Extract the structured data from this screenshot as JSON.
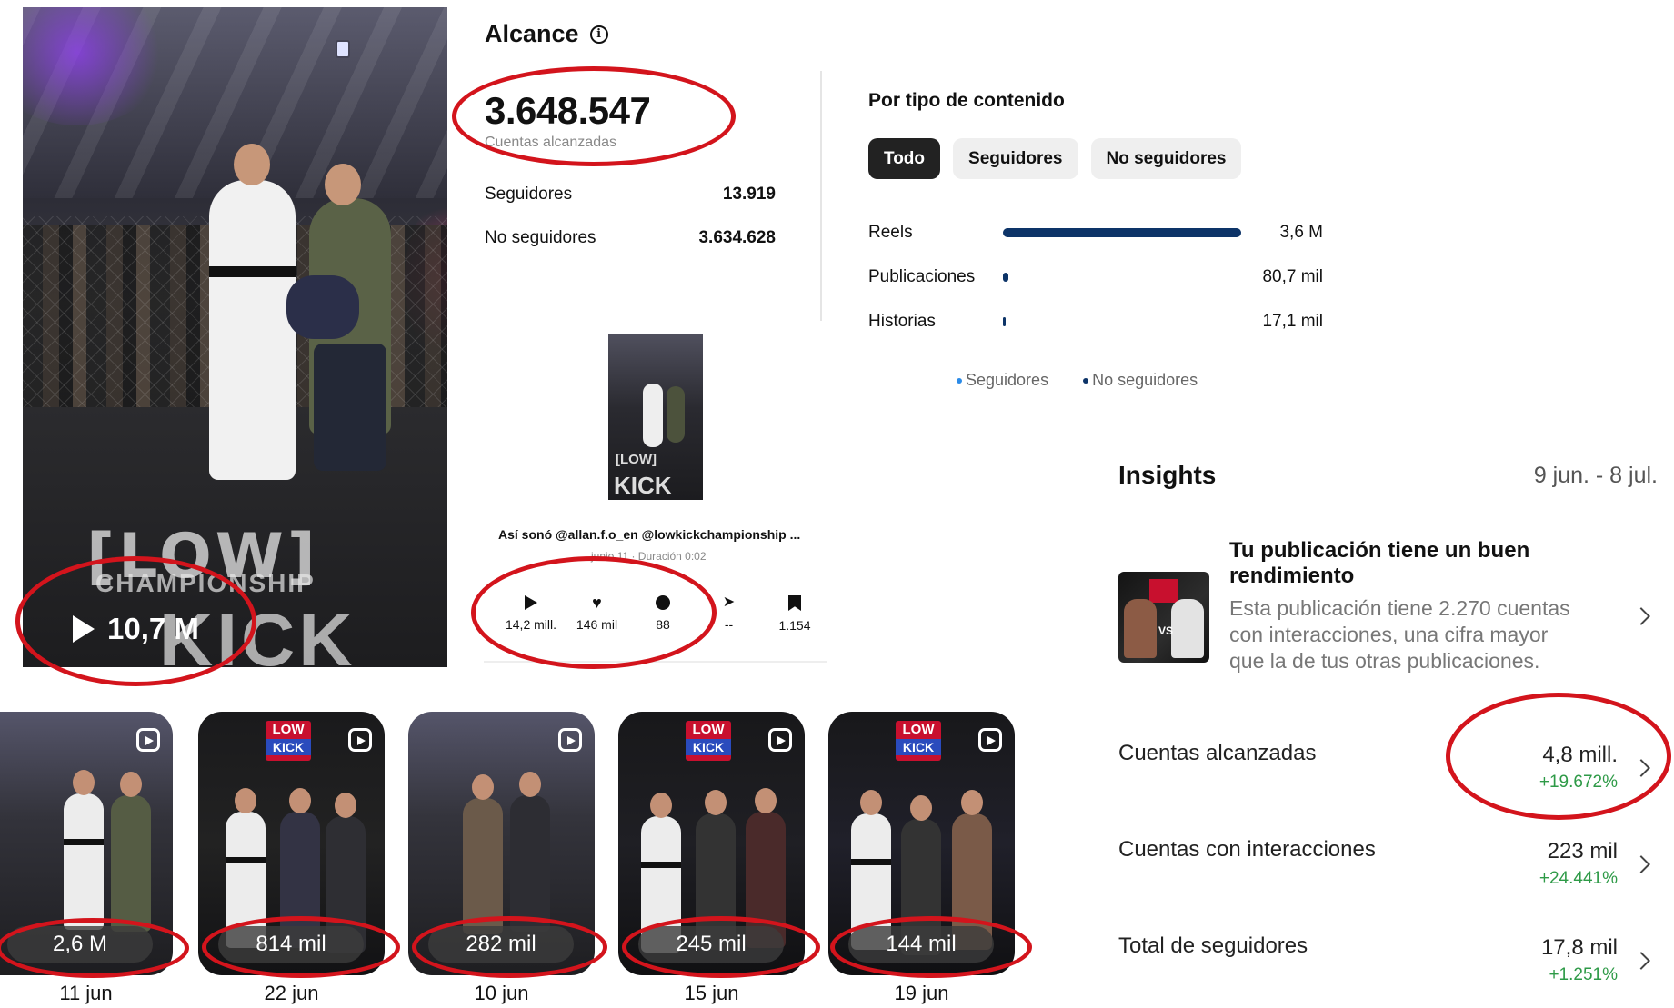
{
  "main_video": {
    "views": "10,7 M"
  },
  "alcance": {
    "title": "Alcance",
    "total": "3.648.547",
    "total_label": "Cuentas alcanzadas",
    "rows": [
      {
        "label": "Seguidores",
        "value": "13.919"
      },
      {
        "label": "No seguidores",
        "value": "3.634.628"
      }
    ]
  },
  "post_card": {
    "caption": "Así sonó @allan.f.o_en @lowkickchampionship ...",
    "date": "junio 11 · Duración 0:02",
    "stats": [
      {
        "icon": "play-icon",
        "value": "14,2 mill."
      },
      {
        "icon": "heart-icon",
        "value": "146 mil"
      },
      {
        "icon": "comment-icon",
        "value": "88"
      },
      {
        "icon": "send-icon",
        "value": "--"
      },
      {
        "icon": "bookmark-icon",
        "value": "1.154"
      }
    ]
  },
  "content_type": {
    "title": "Por tipo de contenido",
    "tabs": [
      "Todo",
      "Seguidores",
      "No seguidores"
    ],
    "active_tab": "Todo",
    "rows": [
      {
        "label": "Reels",
        "value": "3,6 M",
        "fraction": 1.0
      },
      {
        "label": "Publicaciones",
        "value": "80,7 mil",
        "fraction": 0.022
      },
      {
        "label": "Historias",
        "value": "17,1 mil",
        "fraction": 0.005
      }
    ],
    "legend": [
      {
        "label": "Seguidores",
        "color": "#2b8be8"
      },
      {
        "label": "No seguidores",
        "color": "#0d3468"
      }
    ]
  },
  "insights": {
    "title": "Insights",
    "range": "9 jun. - 8 jul.",
    "performance": {
      "title": "Tu publicación tiene un buen rendimiento",
      "description": "Esta publicación tiene 2.270 cuentas con interacciones, una cifra mayor que la de tus otras publicaciones."
    },
    "metrics": [
      {
        "label": "Cuentas alcanzadas",
        "value": "4,8 mill.",
        "delta": "+19.672%"
      },
      {
        "label": "Cuentas con interacciones",
        "value": "223 mil",
        "delta": "+24.441%"
      },
      {
        "label": "Total de seguidores",
        "value": "17,8 mil",
        "delta": "+1.251%"
      }
    ]
  },
  "reels": [
    {
      "views": "2,6 M",
      "date": "11 jun"
    },
    {
      "views": "814 mil",
      "date": "22 jun"
    },
    {
      "views": "282 mil",
      "date": "10 jun"
    },
    {
      "views": "245 mil",
      "date": "15 jun"
    },
    {
      "views": "144 mil",
      "date": "19 jun"
    }
  ],
  "colors": {
    "annotation": "#d3141c",
    "bar": "#0d3468",
    "positive": "#2e9a47"
  }
}
